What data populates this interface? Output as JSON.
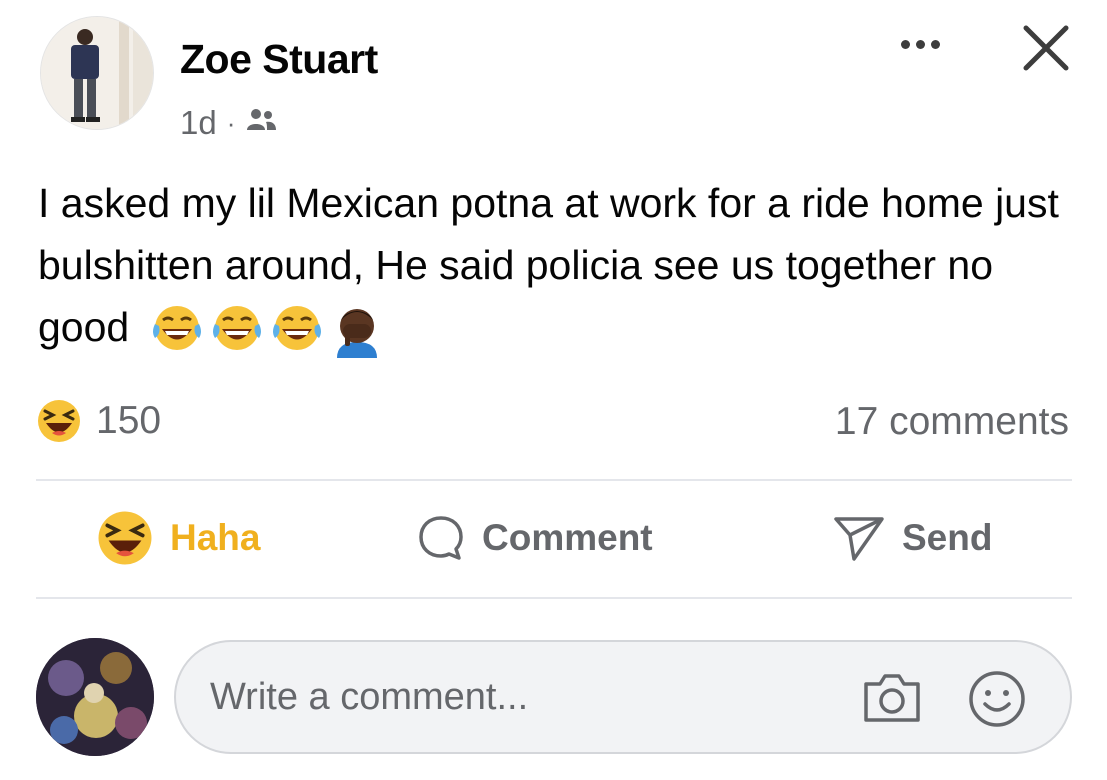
{
  "post": {
    "author_name": "Zoe Stuart",
    "timestamp": "1d",
    "separator": "·",
    "audience_icon": "friends-icon",
    "text": "I asked my lil Mexican potna at work for a ride home just bulshitten around, He said policia see us together no good",
    "emojis": [
      "tears-of-joy-emoji",
      "tears-of-joy-emoji",
      "tears-of-joy-emoji",
      "man-facepalming-emoji"
    ]
  },
  "reactions": {
    "icon": "haha-reaction-icon",
    "count": "150",
    "comments": "17 comments"
  },
  "actions": {
    "haha": "Haha",
    "comment": "Comment",
    "send": "Send"
  },
  "composer": {
    "placeholder": "Write a comment..."
  },
  "colors": {
    "haha_active": "#f0b01e",
    "secondary_text": "#65676b",
    "divider": "#e4e6eb"
  }
}
